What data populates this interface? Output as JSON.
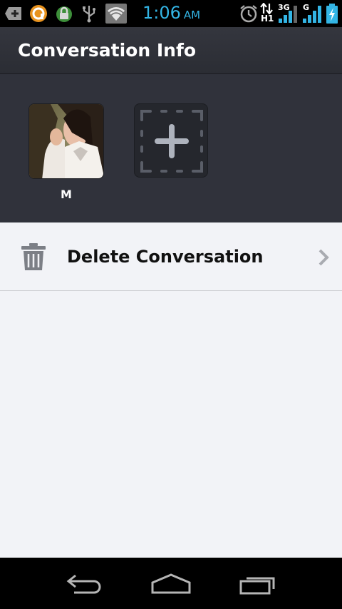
{
  "status_bar": {
    "time": "1:06",
    "ampm": "AM",
    "network_labels": {
      "h1": "H1",
      "three_g": "3G",
      "g": "G"
    },
    "icons": [
      "add-notification-icon",
      "orange-app-icon",
      "lock-icon",
      "usb-icon",
      "wifi-icon",
      "alarm-icon",
      "data-transfer-icon",
      "signal-icon",
      "signal-icon",
      "battery-charging-icon"
    ],
    "time_color": "#33b5e5"
  },
  "header": {
    "title": "Conversation Info"
  },
  "members": [
    {
      "name": "M"
    }
  ],
  "actions": [
    {
      "label": "Delete Conversation",
      "icon": "trash-icon"
    }
  ],
  "nav_bar": {
    "buttons": [
      "back-icon",
      "home-icon",
      "recent-apps-icon"
    ]
  }
}
